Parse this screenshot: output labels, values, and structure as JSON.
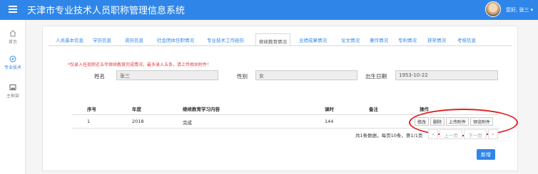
{
  "header": {
    "title": "天津市专业技术人员职称管理信息系统",
    "greeting": "您好, 张三 ▾"
  },
  "sidebar": {
    "items": [
      {
        "label": "首页",
        "icon": "home-icon"
      },
      {
        "label": "专业技术",
        "icon": "compass-icon",
        "active": true
      },
      {
        "label": "主框架",
        "icon": "frame-icon"
      }
    ]
  },
  "tabs": [
    "人员基本信息",
    "学历信息",
    "资历信息",
    "社会团体任职情况",
    "专业技术工作经历",
    "继续教育情况",
    "业绩成果情况",
    "论文情况",
    "著作情况",
    "专利情况",
    "获奖情况",
    "考核信息"
  ],
  "active_tab": "继续教育情况",
  "notice": "*仅录入任现职近五年继续教育完成情况，最多录入五条，请上传相关附件！",
  "form": {
    "name_label": "姓名",
    "name_value": "张三",
    "gender_label": "性别",
    "gender_value": "女",
    "birth_label": "出生日期",
    "birth_value": "1953-10-22"
  },
  "table": {
    "headers": [
      "序号",
      "年度",
      "继续教育学习内容",
      "课时",
      "备注",
      "操作"
    ],
    "rows": [
      {
        "index": "1",
        "year": "2018",
        "content": "完成",
        "hours": "144",
        "remark": ""
      }
    ],
    "actions": [
      "修改",
      "删除",
      "上传附件",
      "预览附件"
    ]
  },
  "pagination": {
    "summary": "共1条数据，每页10条，第1/1页",
    "first": "«",
    "prev": "上一页",
    "next": "下一页",
    "last": "»"
  },
  "add_button": "新增",
  "colors": {
    "accent": "#2f86e8",
    "alert": "#e53b3b",
    "highlight": "#e02020"
  }
}
